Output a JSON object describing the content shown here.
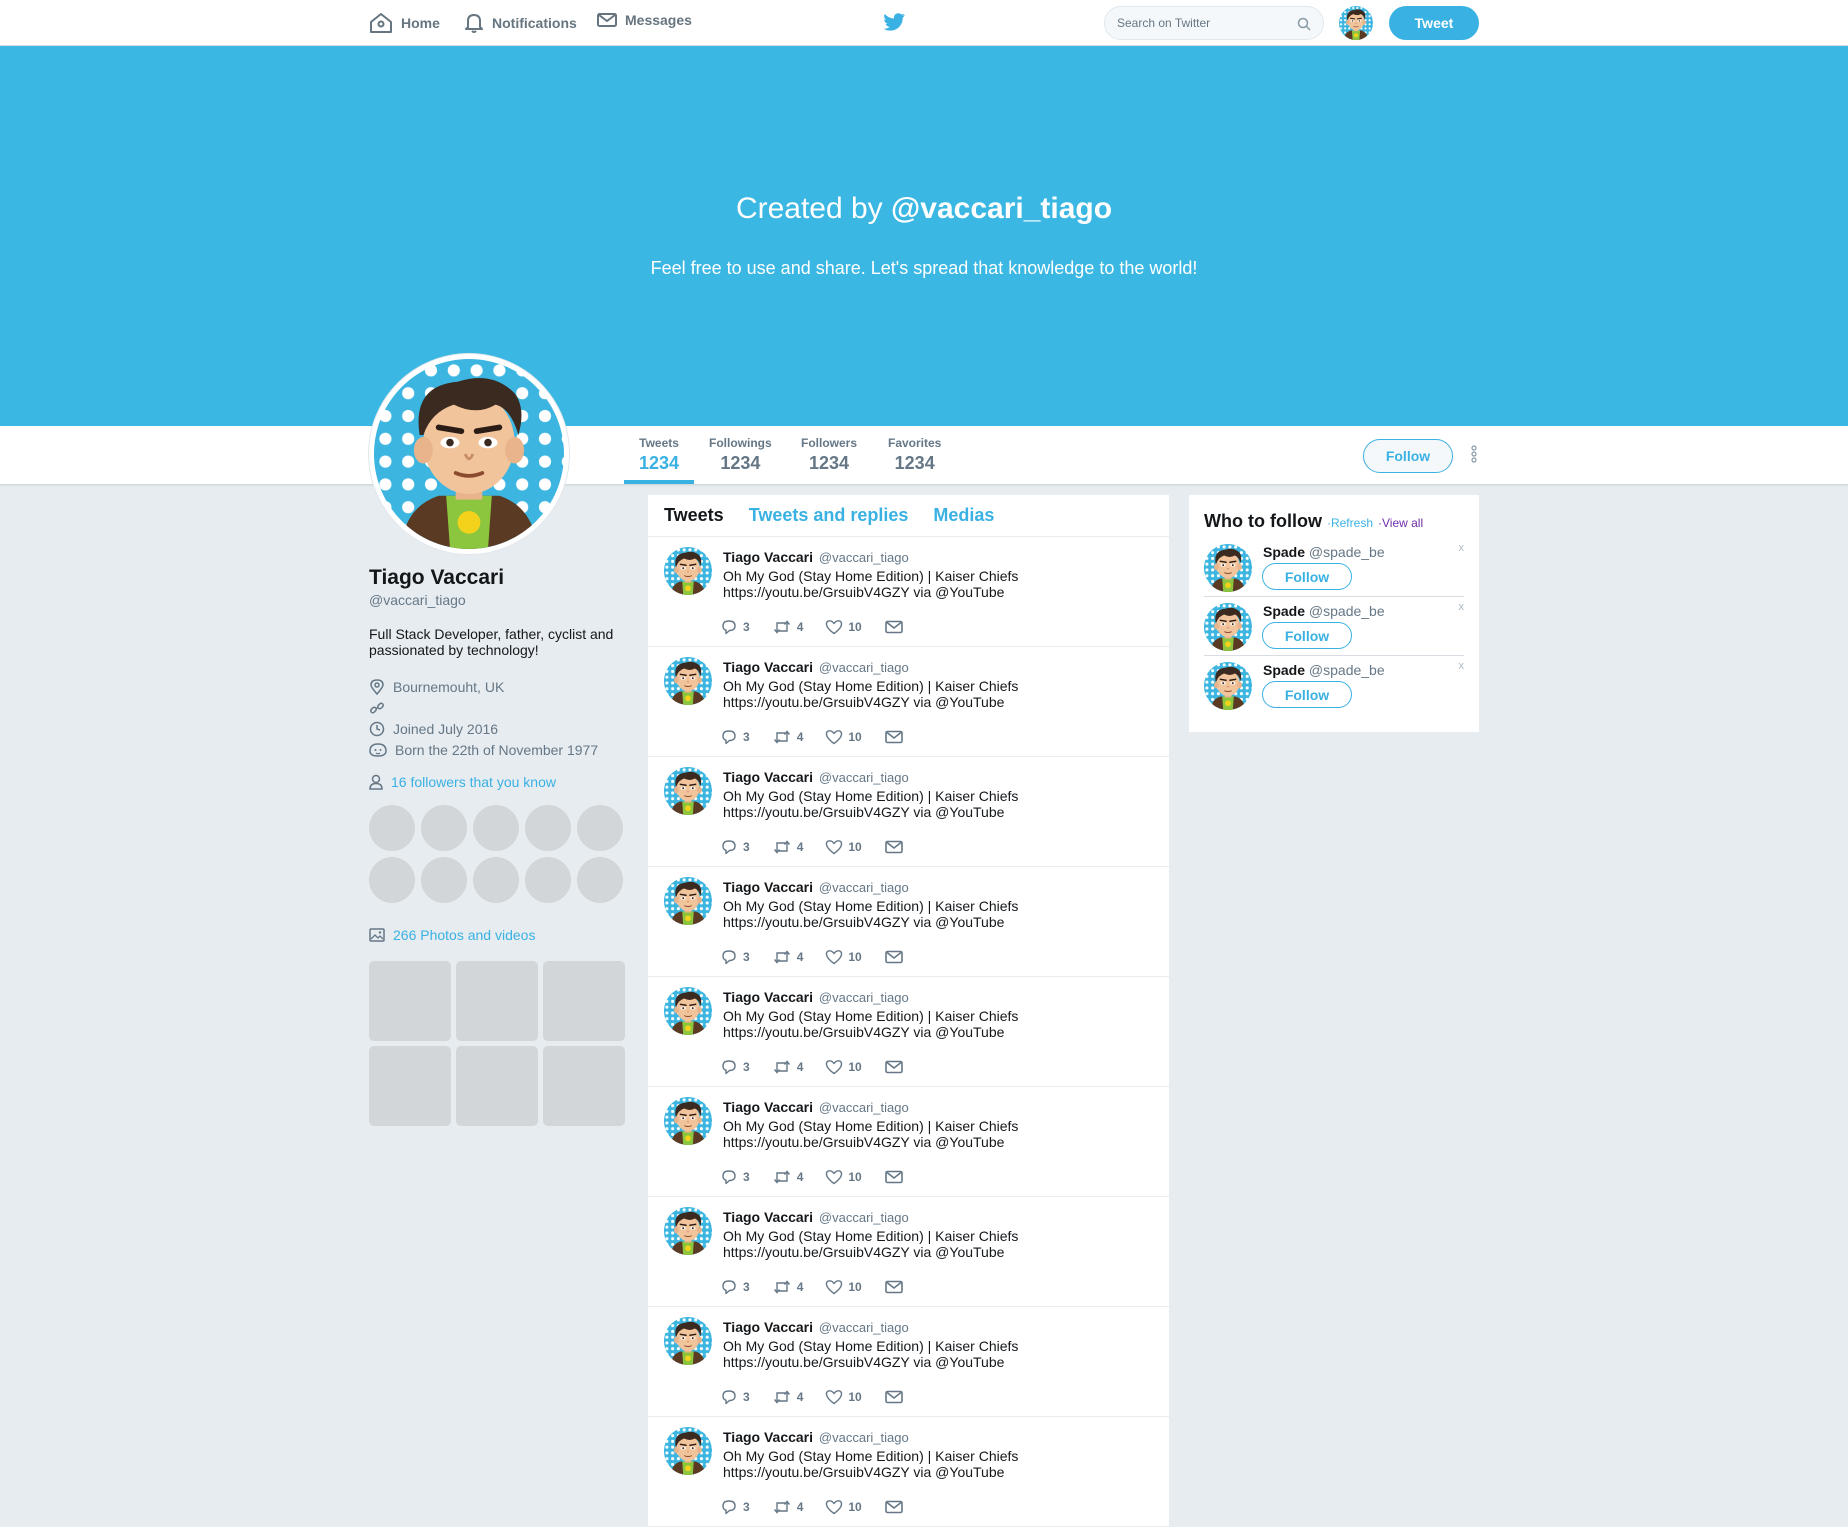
{
  "nav": {
    "home": "Home",
    "notifications": "Notifications",
    "messages": "Messages",
    "search_placeholder": "Search on Twitter",
    "tweet_button": "Tweet"
  },
  "banner": {
    "title_prefix": "Created by ",
    "title_handle": "@vaccari_tiago",
    "subtitle": "Feel free to use and share. Let's spread that knowledge to the world!"
  },
  "stats": [
    {
      "label": "Tweets",
      "value": "1234"
    },
    {
      "label": "Followings",
      "value": "1234"
    },
    {
      "label": "Followers",
      "value": "1234"
    },
    {
      "label": "Favorites",
      "value": "1234"
    }
  ],
  "profile": {
    "follow_button": "Follow",
    "name": "Tiago Vaccari",
    "handle": "@vaccari_tiago",
    "bio": "Full Stack Developer, father, cyclist and passionated by technology!",
    "location": "Bournemouht, UK",
    "website": "",
    "joined": "Joined July 2016",
    "born": "Born the 22th of November 1977",
    "followers_you_know": "16 followers that you know",
    "photos": "266 Photos and videos"
  },
  "timeline": {
    "tabs": [
      "Tweets",
      "Tweets and replies",
      "Medias"
    ],
    "tweets": [
      {
        "name": "Tiago Vaccari",
        "handle": "@vaccari_tiago",
        "line1": "Oh My God (Stay Home Edition) | Kaiser Chiefs",
        "line2": "https://youtu.be/GrsuibV4GZY via @YouTube",
        "replies": "3",
        "retweets": "4",
        "likes": "10"
      },
      {
        "name": "Tiago Vaccari",
        "handle": "@vaccari_tiago",
        "line1": "Oh My God (Stay Home Edition) | Kaiser Chiefs",
        "line2": "https://youtu.be/GrsuibV4GZY via @YouTube",
        "replies": "3",
        "retweets": "4",
        "likes": "10"
      },
      {
        "name": "Tiago Vaccari",
        "handle": "@vaccari_tiago",
        "line1": "Oh My God (Stay Home Edition) | Kaiser Chiefs",
        "line2": "https://youtu.be/GrsuibV4GZY via @YouTube",
        "replies": "3",
        "retweets": "4",
        "likes": "10"
      },
      {
        "name": "Tiago Vaccari",
        "handle": "@vaccari_tiago",
        "line1": "Oh My God (Stay Home Edition) | Kaiser Chiefs",
        "line2": "https://youtu.be/GrsuibV4GZY via @YouTube",
        "replies": "3",
        "retweets": "4",
        "likes": "10"
      },
      {
        "name": "Tiago Vaccari",
        "handle": "@vaccari_tiago",
        "line1": "Oh My God (Stay Home Edition) | Kaiser Chiefs",
        "line2": "https://youtu.be/GrsuibV4GZY via @YouTube",
        "replies": "3",
        "retweets": "4",
        "likes": "10"
      },
      {
        "name": "Tiago Vaccari",
        "handle": "@vaccari_tiago",
        "line1": "Oh My God (Stay Home Edition) | Kaiser Chiefs",
        "line2": "https://youtu.be/GrsuibV4GZY via @YouTube",
        "replies": "3",
        "retweets": "4",
        "likes": "10"
      },
      {
        "name": "Tiago Vaccari",
        "handle": "@vaccari_tiago",
        "line1": "Oh My God (Stay Home Edition) | Kaiser Chiefs",
        "line2": "https://youtu.be/GrsuibV4GZY via @YouTube",
        "replies": "3",
        "retweets": "4",
        "likes": "10"
      },
      {
        "name": "Tiago Vaccari",
        "handle": "@vaccari_tiago",
        "line1": "Oh My God (Stay Home Edition) | Kaiser Chiefs",
        "line2": "https://youtu.be/GrsuibV4GZY via @YouTube",
        "replies": "3",
        "retweets": "4",
        "likes": "10"
      },
      {
        "name": "Tiago Vaccari",
        "handle": "@vaccari_tiago",
        "line1": "Oh My God (Stay Home Edition) | Kaiser Chiefs",
        "line2": "https://youtu.be/GrsuibV4GZY via @YouTube",
        "replies": "3",
        "retweets": "4",
        "likes": "10"
      }
    ]
  },
  "who_to_follow": {
    "title": "Who to follow",
    "refresh": "Refresh",
    "view_all": "View all",
    "separator": "·",
    "close": "x",
    "follow_button": "Follow",
    "users": [
      {
        "name": "Spade",
        "handle": "@spade_be"
      },
      {
        "name": "Spade",
        "handle": "@spade_be"
      },
      {
        "name": "Spade",
        "handle": "@spade_be"
      }
    ]
  },
  "colors": {
    "accent": "#3ab1e3",
    "banner": "#3ab7e2",
    "background": "#e6ecf0",
    "muted_text": "#657786",
    "placeholder_gray": "#d2d6d9"
  },
  "icons": {
    "home": "home-icon",
    "notifications": "bell-icon",
    "messages": "envelope-icon",
    "logo": "twitter-bird-icon",
    "search": "search-icon",
    "location": "location-pin-icon",
    "link": "link-icon",
    "joined": "clock-icon",
    "born": "birthday-icon",
    "followers": "person-icon",
    "photos": "image-icon",
    "reply": "reply-icon",
    "retweet": "retweet-icon",
    "like": "heart-icon",
    "dm": "envelope-icon",
    "more": "more-vertical-icon"
  }
}
